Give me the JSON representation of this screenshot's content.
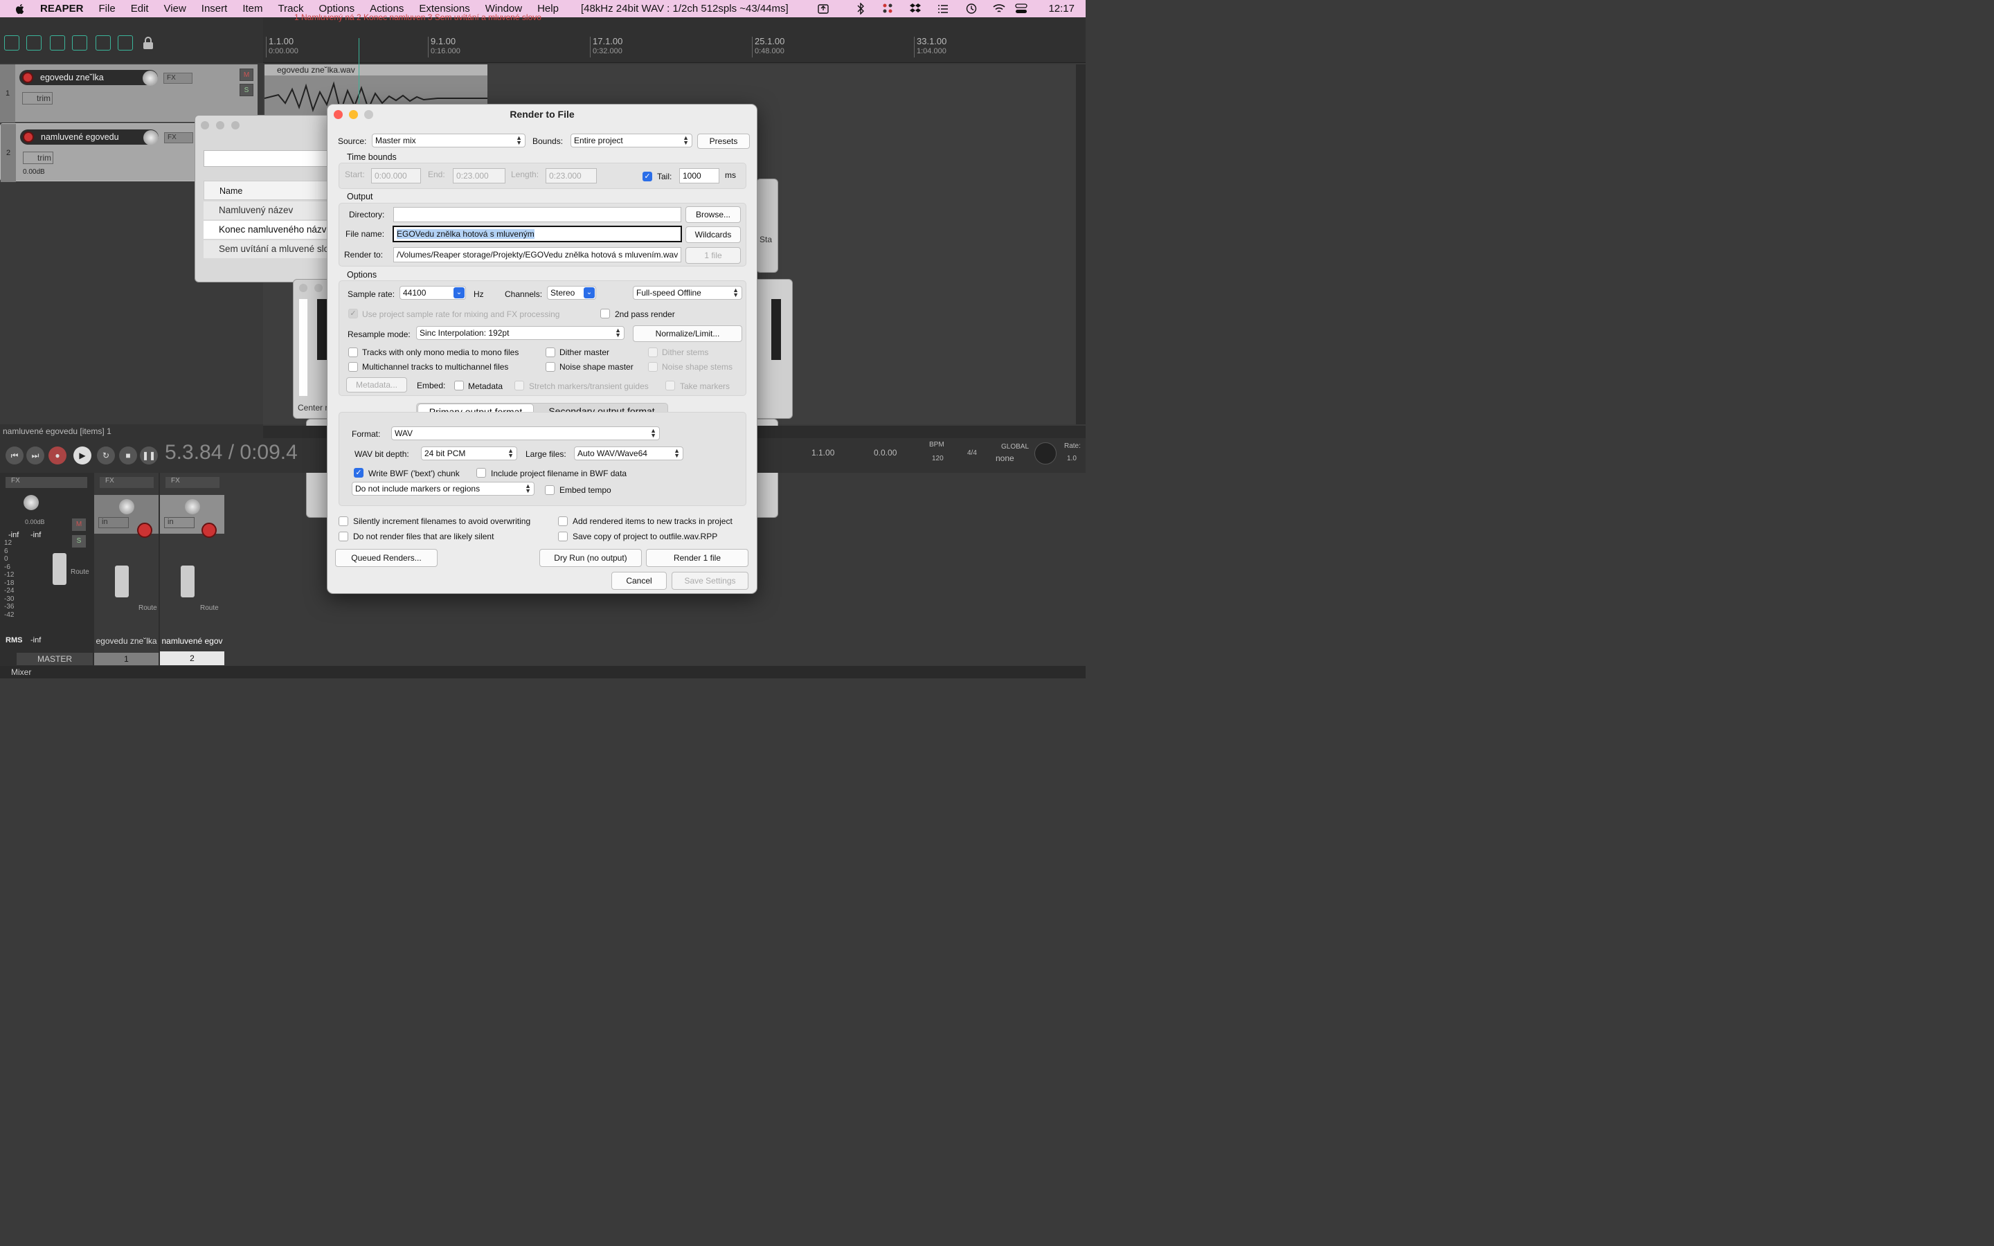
{
  "menubar": {
    "app": "REAPER",
    "items": [
      "File",
      "Edit",
      "View",
      "Insert",
      "Item",
      "Track",
      "Options",
      "Actions",
      "Extensions",
      "Window",
      "Help"
    ],
    "status": "[48kHz 24bit WAV : 1/2ch 512spls ~43/44ms]",
    "clock": "12:17"
  },
  "ruler": {
    "marks": [
      {
        "bar": "1.1.00",
        "time": "0:00.000"
      },
      {
        "bar": "9.1.00",
        "time": "0:16.000"
      },
      {
        "bar": "17.1.00",
        "time": "0:32.000"
      },
      {
        "bar": "25.1.00",
        "time": "0:48.000"
      },
      {
        "bar": "33.1.00",
        "time": "1:04.000"
      }
    ],
    "markers_text": "1 Namluvený ná  2 Konec namluven  3 Sem uvítání a mluvené slovo"
  },
  "tracks": [
    {
      "num": "1",
      "name": "egovedu zne˘lka",
      "fx": "FX",
      "trim": "trim"
    },
    {
      "num": "2",
      "name": "namluvené egovedu",
      "fx": "FX",
      "trim": "trim",
      "vol": "0.00dB"
    }
  ],
  "item": {
    "title": "egovedu zne˘lka.wav"
  },
  "items_status": "namluvené egovedu [items] 1",
  "transport": {
    "time": "5.3.84 / 0:09.4",
    "pos": "1.1.00",
    "len": "0.0.00",
    "bpm_label": "BPM",
    "bpm": "120",
    "sig": "4/4",
    "global": "GLOBAL",
    "global_val": "none",
    "rate": "Rate:",
    "rate_val": "1.0"
  },
  "mixer": {
    "master": "MASTER",
    "strip1": "egovedu zne˘lka",
    "strip2": "namluvené egov",
    "num1": "1",
    "num2": "2",
    "rms": "RMS",
    "inf": "-inf",
    "route": "Route",
    "in": "in",
    "vol": "0.00dB",
    "tab": "Mixer",
    "scale": [
      "12",
      "6",
      "0",
      "-6",
      "-12",
      "-18",
      "-24",
      "-30",
      "-36",
      "-42"
    ]
  },
  "region_window": {
    "col_name": "Name",
    "rows": [
      "Namluvený název",
      "Konec namluveného názvu",
      "Sem uvítání a mluvené slovo"
    ]
  },
  "bg_window": {
    "center": "Center r",
    "sta": "Sta"
  },
  "dialog": {
    "title": "Render to File",
    "source_label": "Source:",
    "source": "Master mix",
    "bounds_label": "Bounds:",
    "bounds": "Entire project",
    "presets": "Presets",
    "time_bounds": "Time bounds",
    "start_label": "Start:",
    "start": "0:00.000",
    "end_label": "End:",
    "end": "0:23.000",
    "length_label": "Length:",
    "length": "0:23.000",
    "tail_label": "Tail:",
    "tail": "1000",
    "tail_unit": "ms",
    "output": "Output",
    "directory_label": "Directory:",
    "directory": "",
    "browse": "Browse...",
    "filename_label": "File name:",
    "filename": "EGOVedu znělka hotová s mluveným",
    "wildcards": "Wildcards",
    "renderto_label": "Render to:",
    "renderto": "/Volumes/Reaper storage/Projekty/EGOVedu znělka hotová s mluvením.wav",
    "one_file": "1 file",
    "options": "Options",
    "samplerate_label": "Sample rate:",
    "samplerate": "44100",
    "hz": "Hz",
    "channels_label": "Channels:",
    "channels": "Stereo",
    "speed": "Full-speed Offline",
    "use_project_rate": "Use project sample rate for mixing and FX processing",
    "second_pass": "2nd pass render",
    "resample_label": "Resample mode:",
    "resample": "Sinc Interpolation: 192pt",
    "normalize": "Normalize/Limit...",
    "mono": "Tracks with only mono media to mono files",
    "multichannel": "Multichannel tracks to multichannel files",
    "dither_master": "Dither master",
    "noise_master": "Noise shape master",
    "dither_stems": "Dither stems",
    "noise_stems": "Noise shape stems",
    "metadata_btn": "Metadata...",
    "embed_label": "Embed:",
    "metadata_cb": "Metadata",
    "stretch": "Stretch markers/transient guides",
    "take_markers": "Take markers",
    "tab_primary": "Primary output format",
    "tab_secondary": "Secondary output format",
    "format_label": "Format:",
    "format": "WAV",
    "bitdepth_label": "WAV bit depth:",
    "bitdepth": "24 bit PCM",
    "largefiles_label": "Large files:",
    "largefiles": "Auto WAV/Wave64",
    "bwf": "Write BWF ('bext') chunk",
    "include_filename": "Include project filename in BWF data",
    "markers_mode": "Do not include markers or regions",
    "embed_tempo": "Embed tempo",
    "silently": "Silently increment filenames to avoid overwriting",
    "add_tracks": "Add rendered items to new tracks in project",
    "silent_files": "Do not render files that are likely silent",
    "save_copy": "Save copy of project to outfile.wav.RPP",
    "queued": "Queued Renders...",
    "dryrun": "Dry Run (no output)",
    "render": "Render 1 file",
    "cancel": "Cancel",
    "save_settings": "Save Settings"
  }
}
